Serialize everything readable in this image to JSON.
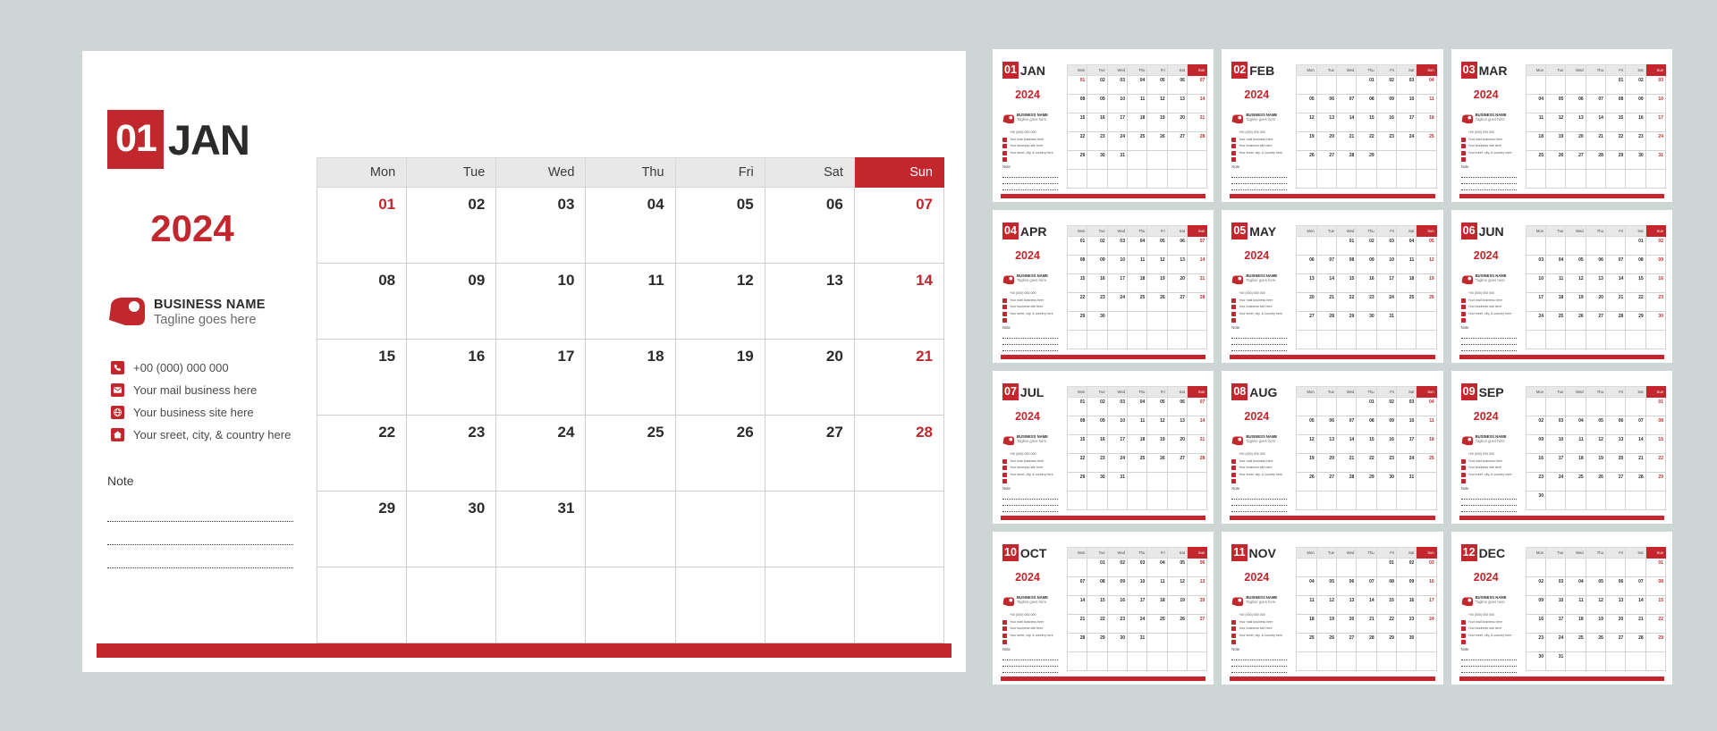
{
  "theme": {
    "accent": "#c1272d",
    "background": "#ced5d5",
    "card": "#ffffff",
    "header_row": "#e8e8e8",
    "text": "#2b2b2b"
  },
  "business": {
    "name": "BUSINESS NAME",
    "tagline": "Tagline goes here",
    "contacts": [
      {
        "icon": "phone-icon",
        "text": "+00 (000) 000 000"
      },
      {
        "icon": "mail-icon",
        "text": "Your mail business here"
      },
      {
        "icon": "globe-icon",
        "text": "Your business site here"
      },
      {
        "icon": "home-icon",
        "text": "Your sreet, city, & country here"
      }
    ],
    "note_label": "Note"
  },
  "year": "2024",
  "weekdays": [
    "Mon",
    "Tue",
    "Wed",
    "Thu",
    "Fri",
    "Sat",
    "Sun"
  ],
  "featured": {
    "number": "01",
    "abbr": "JAN",
    "year": "2024",
    "weeks": [
      [
        "01",
        "02",
        "03",
        "04",
        "05",
        "06",
        "07"
      ],
      [
        "08",
        "09",
        "10",
        "11",
        "12",
        "13",
        "14"
      ],
      [
        "15",
        "16",
        "17",
        "18",
        "19",
        "20",
        "21"
      ],
      [
        "22",
        "23",
        "24",
        "25",
        "26",
        "27",
        "28"
      ],
      [
        "29",
        "30",
        "31",
        "",
        "",
        "",
        ""
      ],
      [
        "",
        "",
        "",
        "",
        "",
        "",
        ""
      ]
    ],
    "red_cells": [
      "0-0"
    ]
  },
  "months": [
    {
      "number": "01",
      "abbr": "JAN",
      "weeks": [
        [
          "01",
          "02",
          "03",
          "04",
          "05",
          "06",
          "07"
        ],
        [
          "08",
          "09",
          "10",
          "11",
          "12",
          "13",
          "14"
        ],
        [
          "15",
          "16",
          "17",
          "18",
          "19",
          "20",
          "21"
        ],
        [
          "22",
          "23",
          "24",
          "25",
          "26",
          "27",
          "28"
        ],
        [
          "29",
          "30",
          "31",
          "",
          "",
          "",
          ""
        ],
        [
          "",
          "",
          "",
          "",
          "",
          "",
          ""
        ]
      ],
      "red_cells": [
        "0-0"
      ]
    },
    {
      "number": "02",
      "abbr": "FEB",
      "weeks": [
        [
          "",
          "",
          "",
          "01",
          "02",
          "03",
          "04"
        ],
        [
          "05",
          "06",
          "07",
          "08",
          "09",
          "10",
          "11"
        ],
        [
          "12",
          "13",
          "14",
          "15",
          "16",
          "17",
          "18"
        ],
        [
          "19",
          "20",
          "21",
          "22",
          "23",
          "24",
          "25"
        ],
        [
          "26",
          "27",
          "28",
          "29",
          "",
          "",
          ""
        ],
        [
          "",
          "",
          "",
          "",
          "",
          "",
          ""
        ]
      ],
      "red_cells": []
    },
    {
      "number": "03",
      "abbr": "MAR",
      "weeks": [
        [
          "",
          "",
          "",
          "",
          "01",
          "02",
          "03"
        ],
        [
          "04",
          "05",
          "06",
          "07",
          "08",
          "09",
          "10"
        ],
        [
          "11",
          "12",
          "13",
          "14",
          "15",
          "16",
          "17"
        ],
        [
          "18",
          "19",
          "20",
          "21",
          "22",
          "23",
          "24"
        ],
        [
          "25",
          "26",
          "27",
          "28",
          "29",
          "30",
          "31"
        ],
        [
          "",
          "",
          "",
          "",
          "",
          "",
          ""
        ]
      ],
      "red_cells": []
    },
    {
      "number": "04",
      "abbr": "APR",
      "weeks": [
        [
          "01",
          "02",
          "03",
          "04",
          "05",
          "06",
          "07"
        ],
        [
          "08",
          "09",
          "10",
          "11",
          "12",
          "13",
          "14"
        ],
        [
          "15",
          "16",
          "17",
          "18",
          "19",
          "20",
          "21"
        ],
        [
          "22",
          "23",
          "24",
          "25",
          "26",
          "27",
          "28"
        ],
        [
          "29",
          "30",
          "",
          "",
          "",
          "",
          ""
        ],
        [
          "",
          "",
          "",
          "",
          "",
          "",
          ""
        ]
      ],
      "red_cells": []
    },
    {
      "number": "05",
      "abbr": "MAY",
      "weeks": [
        [
          "",
          "",
          "01",
          "02",
          "03",
          "04",
          "05"
        ],
        [
          "06",
          "07",
          "08",
          "09",
          "10",
          "11",
          "12"
        ],
        [
          "13",
          "14",
          "15",
          "16",
          "17",
          "18",
          "19"
        ],
        [
          "20",
          "21",
          "22",
          "23",
          "24",
          "25",
          "26"
        ],
        [
          "27",
          "28",
          "29",
          "30",
          "31",
          "",
          ""
        ],
        [
          "",
          "",
          "",
          "",
          "",
          "",
          ""
        ]
      ],
      "red_cells": []
    },
    {
      "number": "06",
      "abbr": "JUN",
      "weeks": [
        [
          "",
          "",
          "",
          "",
          "",
          "01",
          "02"
        ],
        [
          "03",
          "04",
          "05",
          "06",
          "07",
          "08",
          "09"
        ],
        [
          "10",
          "11",
          "12",
          "13",
          "14",
          "15",
          "16"
        ],
        [
          "17",
          "18",
          "19",
          "20",
          "21",
          "22",
          "23"
        ],
        [
          "24",
          "25",
          "26",
          "27",
          "28",
          "29",
          "30"
        ],
        [
          "",
          "",
          "",
          "",
          "",
          "",
          ""
        ]
      ],
      "red_cells": []
    },
    {
      "number": "07",
      "abbr": "JUL",
      "weeks": [
        [
          "01",
          "02",
          "03",
          "04",
          "05",
          "06",
          "07"
        ],
        [
          "08",
          "09",
          "10",
          "11",
          "12",
          "13",
          "14"
        ],
        [
          "15",
          "16",
          "17",
          "18",
          "19",
          "20",
          "21"
        ],
        [
          "22",
          "23",
          "24",
          "25",
          "26",
          "27",
          "28"
        ],
        [
          "29",
          "30",
          "31",
          "",
          "",
          "",
          ""
        ],
        [
          "",
          "",
          "",
          "",
          "",
          "",
          ""
        ]
      ],
      "red_cells": []
    },
    {
      "number": "08",
      "abbr": "AUG",
      "weeks": [
        [
          "",
          "",
          "",
          "01",
          "02",
          "03",
          "04"
        ],
        [
          "05",
          "06",
          "07",
          "08",
          "09",
          "10",
          "11"
        ],
        [
          "12",
          "13",
          "14",
          "15",
          "16",
          "17",
          "18"
        ],
        [
          "19",
          "20",
          "21",
          "22",
          "23",
          "24",
          "25"
        ],
        [
          "26",
          "27",
          "28",
          "29",
          "30",
          "31",
          ""
        ],
        [
          "",
          "",
          "",
          "",
          "",
          "",
          ""
        ]
      ],
      "red_cells": []
    },
    {
      "number": "09",
      "abbr": "SEP",
      "weeks": [
        [
          "",
          "",
          "",
          "",
          "",
          "",
          "01"
        ],
        [
          "02",
          "03",
          "04",
          "05",
          "06",
          "07",
          "08"
        ],
        [
          "09",
          "10",
          "11",
          "12",
          "13",
          "14",
          "15"
        ],
        [
          "16",
          "17",
          "18",
          "19",
          "20",
          "21",
          "22"
        ],
        [
          "23",
          "24",
          "25",
          "26",
          "27",
          "28",
          "29"
        ],
        [
          "30",
          "",
          "",
          "",
          "",
          "",
          ""
        ]
      ],
      "red_cells": []
    },
    {
      "number": "10",
      "abbr": "OCT",
      "weeks": [
        [
          "",
          "01",
          "02",
          "03",
          "04",
          "05",
          "06"
        ],
        [
          "07",
          "08",
          "09",
          "10",
          "11",
          "12",
          "13"
        ],
        [
          "14",
          "15",
          "16",
          "17",
          "18",
          "19",
          "20"
        ],
        [
          "21",
          "22",
          "23",
          "24",
          "25",
          "26",
          "27"
        ],
        [
          "28",
          "29",
          "30",
          "31",
          "",
          "",
          ""
        ],
        [
          "",
          "",
          "",
          "",
          "",
          "",
          ""
        ]
      ],
      "red_cells": []
    },
    {
      "number": "11",
      "abbr": "NOV",
      "weeks": [
        [
          "",
          "",
          "",
          "",
          "01",
          "02",
          "03"
        ],
        [
          "04",
          "05",
          "06",
          "07",
          "08",
          "09",
          "10"
        ],
        [
          "11",
          "12",
          "13",
          "14",
          "15",
          "16",
          "17"
        ],
        [
          "18",
          "19",
          "20",
          "21",
          "22",
          "23",
          "24"
        ],
        [
          "25",
          "26",
          "27",
          "28",
          "29",
          "30",
          ""
        ],
        [
          "",
          "",
          "",
          "",
          "",
          "",
          ""
        ]
      ],
      "red_cells": []
    },
    {
      "number": "12",
      "abbr": "DEC",
      "weeks": [
        [
          "",
          "",
          "",
          "",
          "",
          "",
          "01"
        ],
        [
          "02",
          "03",
          "04",
          "05",
          "06",
          "07",
          "08"
        ],
        [
          "09",
          "10",
          "11",
          "12",
          "13",
          "14",
          "15"
        ],
        [
          "16",
          "17",
          "18",
          "19",
          "20",
          "21",
          "22"
        ],
        [
          "23",
          "24",
          "25",
          "26",
          "27",
          "28",
          "29"
        ],
        [
          "30",
          "31",
          "",
          "",
          "",
          "",
          ""
        ]
      ],
      "red_cells": []
    }
  ]
}
